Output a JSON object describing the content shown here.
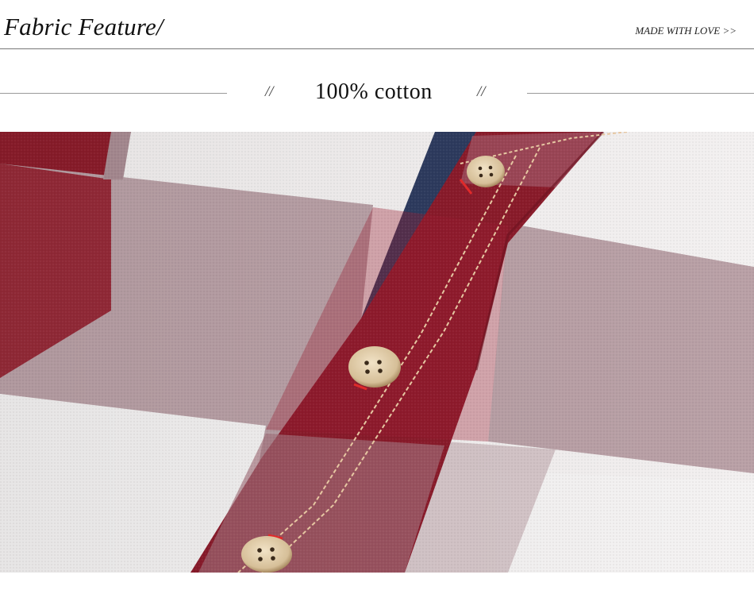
{
  "header": {
    "title": "Fabric Feature/",
    "tagline": "MADE WITH LOVE >>"
  },
  "section": {
    "left_slashes": "//",
    "heading": "100% cotton",
    "right_slashes": "//"
  },
  "photo": {
    "subject": "plaid-shirt-placket-closeup",
    "colors": {
      "burgundy": "#8e1b2c",
      "dusty_pink": "#b79ea4",
      "off_white": "#f2efef",
      "denim": "#2d3a5e",
      "button": "#d8c3a0",
      "stitch": "#e8c9a4",
      "thread_red": "#e02a2a"
    }
  }
}
